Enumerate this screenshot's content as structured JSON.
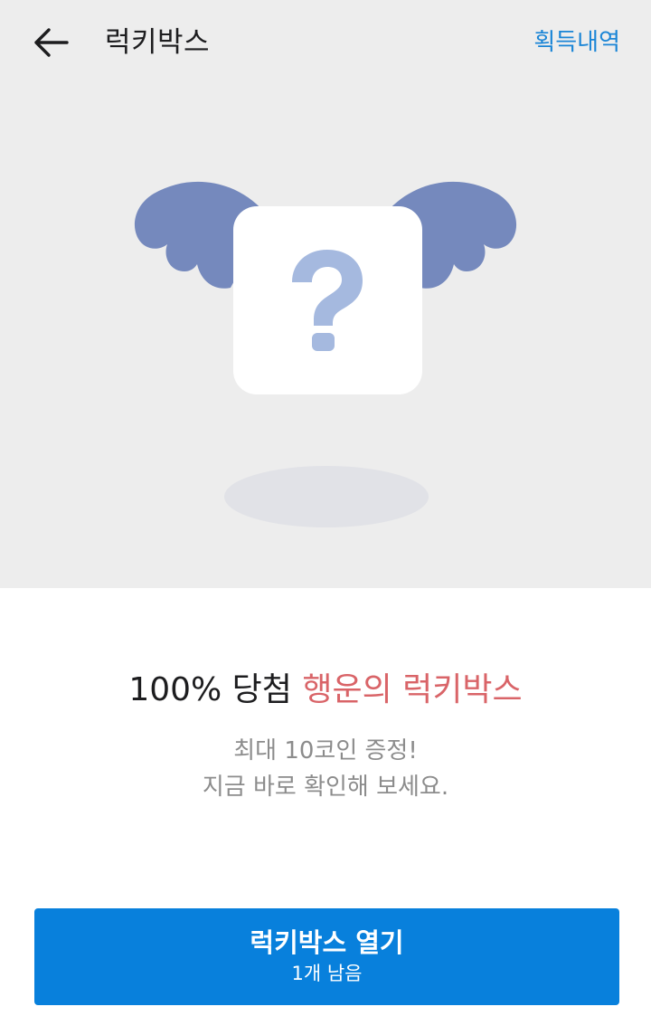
{
  "header": {
    "title": "럭키박스",
    "history_label": "획득내역"
  },
  "illustration": {
    "symbol": "?"
  },
  "promo": {
    "headline_prefix": "100% 당첨",
    "headline_highlight": "행운의 럭키박스",
    "subtext_line1": "최대 10코인 증정!",
    "subtext_line2": "지금 바로 확인해 보세요."
  },
  "action": {
    "open_label": "럭키박스 열기",
    "remaining": "1개 남음"
  },
  "colors": {
    "hero_bg": "#ededed",
    "accent_blue": "#0880dc",
    "link_blue": "#1a85d6",
    "highlight_red": "#d96468",
    "wing": "#7589bd",
    "question_mark": "#a5b9df"
  },
  "icons": {
    "back": "arrow-left-icon",
    "box": "mystery-box-icon",
    "wings": "wings-icon"
  }
}
